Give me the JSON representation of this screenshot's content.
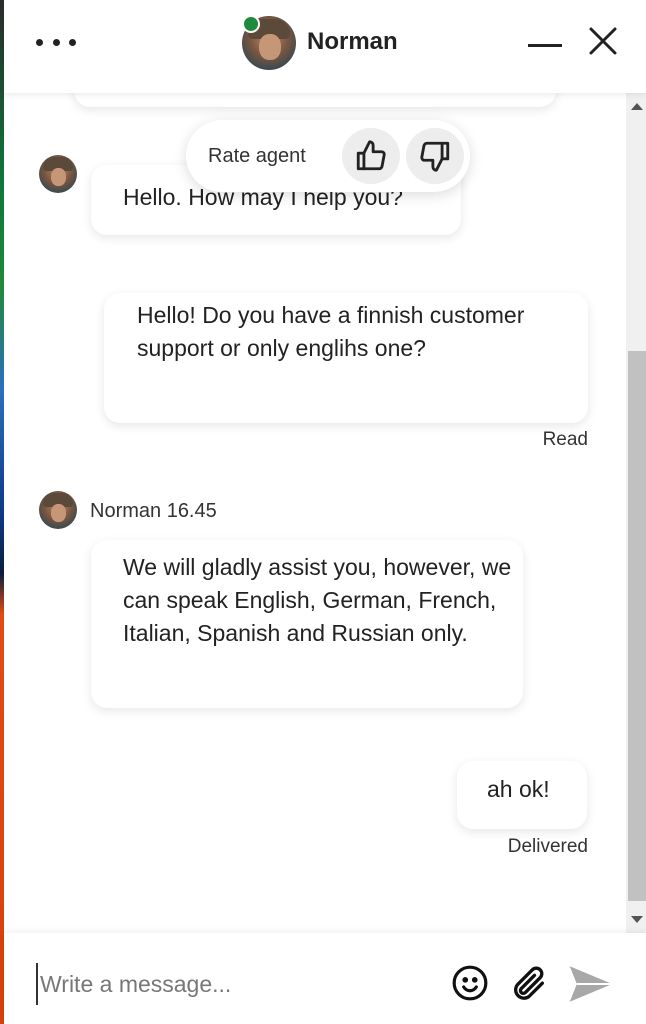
{
  "header": {
    "agent_name": "Norman",
    "status": "online",
    "status_color": "#1e8a3b",
    "menu_icon": "more-dots-icon",
    "minimize_icon": "minimize-icon",
    "close_icon": "close-icon"
  },
  "rating": {
    "label": "Rate agent",
    "thumbs_up_icon": "thumbs-up-icon",
    "thumbs_down_icon": "thumbs-down-icon"
  },
  "messages": [
    {
      "sender": "agent",
      "text": "Hello. How may I help you?"
    },
    {
      "sender": "user",
      "text": "Hello! Do you have a finnish customer support or only englihs one?",
      "status": "Read"
    },
    {
      "sender": "agent",
      "meta": "Norman 16.45",
      "text": "We will gladly assist you, however, we can speak English, German, French, Italian, Spanish and Russian only."
    },
    {
      "sender": "user",
      "text": "ah ok!",
      "status": "Delivered"
    }
  ],
  "composer": {
    "placeholder": "Write a message...",
    "value": "",
    "emoji_icon": "emoji-icon",
    "attach_icon": "paperclip-icon",
    "send_icon": "send-icon"
  }
}
